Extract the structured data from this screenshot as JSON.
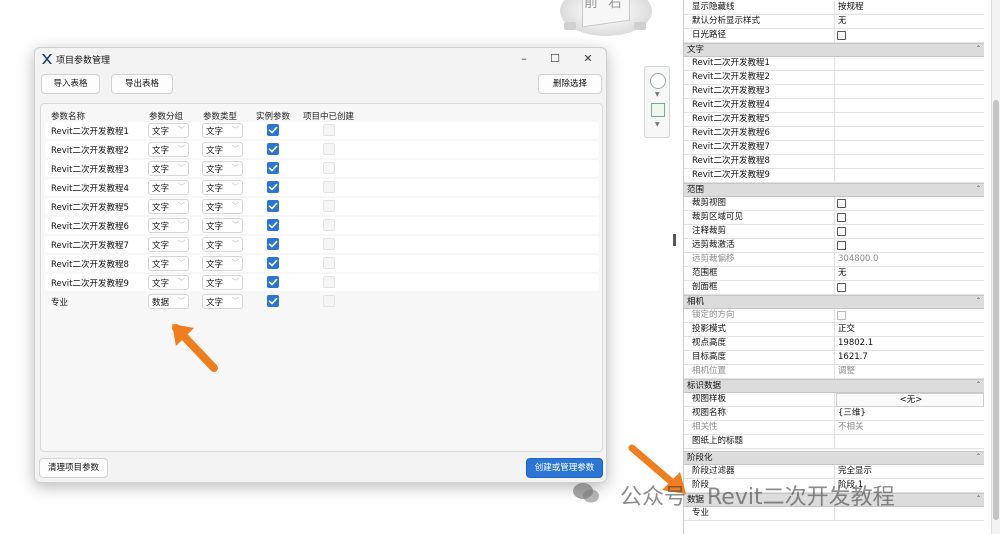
{
  "viewcube": {
    "left_text": "前",
    "right_text": "右"
  },
  "dialog": {
    "title": "项目参数管理",
    "buttons": {
      "import": "导入表格",
      "export": "导出表格",
      "delete": "删除选择",
      "clear": "清理项目参数",
      "create": "创建或管理参数"
    },
    "headers": [
      "参数名称",
      "参数分组",
      "参数类型",
      "实例参数",
      "项目中已创建"
    ],
    "rows": [
      {
        "name": "Revit二次开发教程1",
        "group": "文字",
        "type": "文字"
      },
      {
        "name": "Revit二次开发教程2",
        "group": "文字",
        "type": "文字"
      },
      {
        "name": "Revit二次开发教程3",
        "group": "文字",
        "type": "文字"
      },
      {
        "name": "Revit二次开发教程4",
        "group": "文字",
        "type": "文字"
      },
      {
        "name": "Revit二次开发教程5",
        "group": "文字",
        "type": "文字"
      },
      {
        "name": "Revit二次开发教程6",
        "group": "文字",
        "type": "文字"
      },
      {
        "name": "Revit二次开发教程7",
        "group": "文字",
        "type": "文字"
      },
      {
        "name": "Revit二次开发教程8",
        "group": "文字",
        "type": "文字"
      },
      {
        "name": "Revit二次开发教程9",
        "group": "文字",
        "type": "文字"
      },
      {
        "name": "专业",
        "group": "数据",
        "type": "文字"
      }
    ],
    "colors": {
      "primary": "#2a75d6",
      "check": "#2a75d6"
    }
  },
  "props": {
    "top": [
      {
        "name": "显示隐藏线",
        "value": "按规程"
      },
      {
        "name": "默认分析显示样式",
        "value": "无"
      },
      {
        "name": "日光路径",
        "value": ""
      }
    ],
    "sections": {
      "text": "文字",
      "extents": "范围",
      "camera": "相机",
      "identity": "标识数据",
      "phasing": "阶段化",
      "data": "数据"
    },
    "text_rows": [
      "Revit二次开发教程1",
      "Revit二次开发教程2",
      "Revit二次开发教程3",
      "Revit二次开发教程4",
      "Revit二次开发教程5",
      "Revit二次开发教程6",
      "Revit二次开发教程7",
      "Revit二次开发教程8",
      "Revit二次开发教程9"
    ],
    "extents_rows": [
      {
        "name": "裁剪视图",
        "value": ""
      },
      {
        "name": "裁剪区域可见",
        "value": ""
      },
      {
        "name": "注释裁剪",
        "value": ""
      },
      {
        "name": "远剪裁激活",
        "value": ""
      },
      {
        "name": "远剪裁偏移",
        "value": "304800.0"
      },
      {
        "name": "范围框",
        "value": "无"
      },
      {
        "name": "剖面框",
        "value": ""
      }
    ],
    "camera_rows": [
      {
        "name": "锁定的方向",
        "value": ""
      },
      {
        "name": "投影模式",
        "value": "正交"
      },
      {
        "name": "视点高度",
        "value": "19802.1"
      },
      {
        "name": "目标高度",
        "value": "1621.7"
      },
      {
        "name": "相机位置",
        "value": "调整"
      }
    ],
    "identity_rows": [
      {
        "name": "视图样板",
        "value": "<无>"
      },
      {
        "name": "视图名称",
        "value": "{三维}"
      },
      {
        "name": "相关性",
        "value": "不相关"
      },
      {
        "name": "图纸上的标题",
        "value": ""
      }
    ],
    "phasing_rows": [
      {
        "name": "阶段过滤器",
        "value": "完全显示"
      },
      {
        "name": "阶段",
        "value": "阶段 1"
      }
    ],
    "data_rows": [
      {
        "name": "专业",
        "value": ""
      }
    ]
  },
  "watermark": {
    "text": "公众号 · Revit二次开发教程"
  },
  "colors": {
    "arrow": "#f07d1e"
  }
}
